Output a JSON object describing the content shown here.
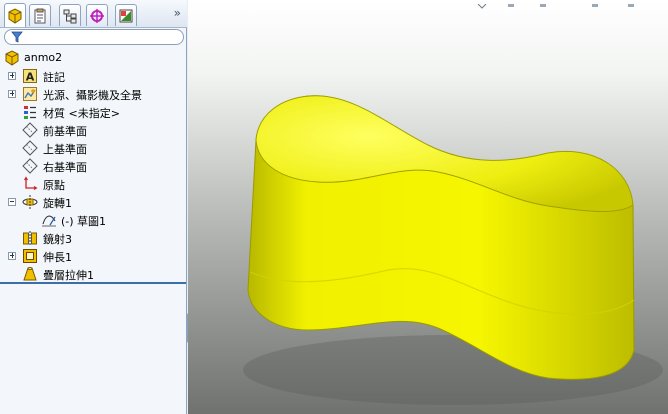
{
  "feature_manager": {
    "tabs": [
      {
        "name": "featuremanager-tab",
        "active": true
      },
      {
        "name": "propertymanager-tab",
        "active": false
      },
      {
        "name": "configurationmanager-tab",
        "active": false
      },
      {
        "name": "dimxpert-tab",
        "active": false
      },
      {
        "name": "display-manager-tab",
        "active": false
      }
    ],
    "more_tabs": "»",
    "filter": {
      "placeholder": ""
    },
    "tree": [
      {
        "id": "root",
        "label": "anmo2",
        "icon": "part-icon",
        "expander": "none",
        "level": 0
      },
      {
        "id": "annotations",
        "label": "註記",
        "icon": "annotation-icon",
        "expander": "plus",
        "level": 1
      },
      {
        "id": "lights",
        "label": "光源、攝影機及全景",
        "icon": "lights-scene-icon",
        "expander": "plus",
        "level": 1
      },
      {
        "id": "material",
        "label": "材質 <未指定>",
        "icon": "material-icon",
        "expander": "none",
        "level": 1
      },
      {
        "id": "front-plane",
        "label": "前基準面",
        "icon": "plane-icon",
        "expander": "none",
        "level": 1
      },
      {
        "id": "top-plane",
        "label": "上基準面",
        "icon": "plane-icon",
        "expander": "none",
        "level": 1
      },
      {
        "id": "right-plane",
        "label": "右基準面",
        "icon": "plane-icon",
        "expander": "none",
        "level": 1
      },
      {
        "id": "origin",
        "label": "原點",
        "icon": "origin-icon",
        "expander": "none",
        "level": 1
      },
      {
        "id": "revolve",
        "label": "旋轉1",
        "icon": "revolve-icon",
        "expander": "minus",
        "level": 1
      },
      {
        "id": "sketch",
        "label": "(-) 草圖1",
        "icon": "sketch-icon",
        "expander": "none",
        "level": 2
      },
      {
        "id": "mirror",
        "label": "鏡射3",
        "icon": "mirror-icon",
        "expander": "none",
        "level": 1
      },
      {
        "id": "extrude",
        "label": "伸長1",
        "icon": "extrude-icon",
        "expander": "plus",
        "level": 1
      },
      {
        "id": "loft",
        "label": "疊層拉伸1",
        "icon": "loft-icon",
        "expander": "none",
        "level": 1
      }
    ]
  },
  "graphics_area": {
    "model_color": "#e8e800",
    "background_top": "#ffffff",
    "background_bottom": "#6f726f"
  },
  "panel_splitter": {
    "icon": "collapse-arrows-icon"
  }
}
